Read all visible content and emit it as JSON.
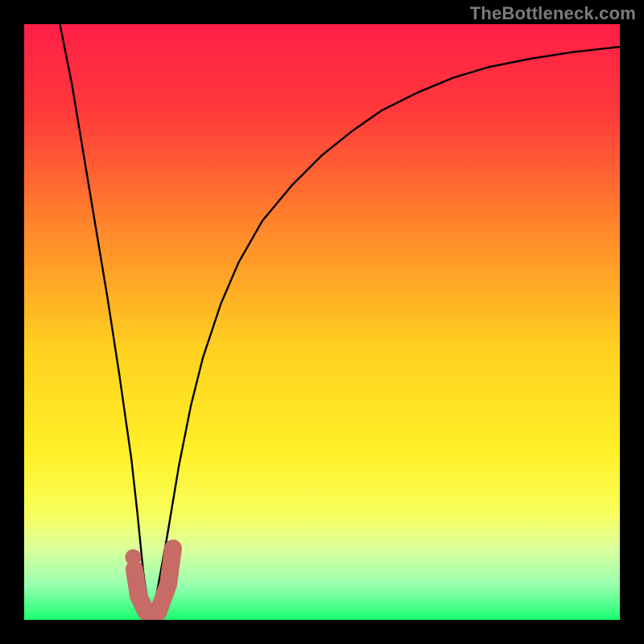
{
  "watermark": {
    "text": "TheBottleneck.com"
  },
  "colors": {
    "frame": "#000000",
    "gradient_stops": [
      {
        "offset": 0.0,
        "color": "#ff1f47"
      },
      {
        "offset": 0.15,
        "color": "#ff3a3a"
      },
      {
        "offset": 0.35,
        "color": "#ff8a2a"
      },
      {
        "offset": 0.55,
        "color": "#ffd21f"
      },
      {
        "offset": 0.72,
        "color": "#fff028"
      },
      {
        "offset": 0.82,
        "color": "#f8ff5a"
      },
      {
        "offset": 0.88,
        "color": "#dcff9c"
      },
      {
        "offset": 0.94,
        "color": "#9bffb0"
      },
      {
        "offset": 1.0,
        "color": "#19ff70"
      }
    ],
    "curve": "#000000",
    "marker_stroke": "#c76b66",
    "marker_dot": "#c76b66"
  },
  "chart_data": {
    "type": "line",
    "title": "",
    "xlabel": "",
    "ylabel": "",
    "xlim": [
      0,
      100
    ],
    "ylim": [
      0,
      100
    ],
    "grid": false,
    "annotations": [],
    "series": [
      {
        "name": "bottleneck-curve",
        "x": [
          6,
          8,
          10,
          12,
          14,
          16,
          18,
          19,
          20,
          21,
          22,
          24,
          26,
          28,
          30,
          33,
          36,
          40,
          45,
          50,
          55,
          60,
          66,
          72,
          78,
          85,
          92,
          100
        ],
        "y": [
          100,
          90,
          78,
          66,
          54,
          41,
          27,
          18,
          8,
          1,
          3,
          14,
          26,
          36,
          44,
          53,
          60,
          67,
          73,
          78,
          82,
          85.5,
          88.5,
          91,
          92.8,
          94.2,
          95.3,
          96.2
        ]
      }
    ],
    "optimal_marker": {
      "name": "optimal-point",
      "hook_path_xy": [
        [
          18.5,
          8.5
        ],
        [
          19.2,
          4.0
        ],
        [
          20.5,
          1.3
        ],
        [
          22.5,
          1.3
        ],
        [
          24.2,
          6.0
        ],
        [
          25.0,
          12.0
        ]
      ],
      "dot_xy": [
        18.3,
        10.5
      ]
    }
  }
}
